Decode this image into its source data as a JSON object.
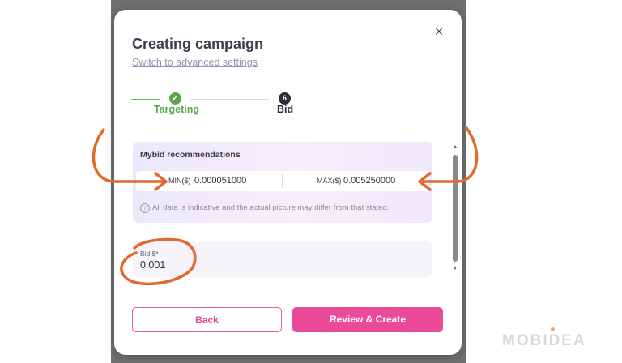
{
  "modal": {
    "title": "Creating campaign",
    "advanced_link": "Switch to advanced settings",
    "close_glyph": "×"
  },
  "stepper": {
    "steps": [
      {
        "label": "Targeting",
        "marker": "✓",
        "state": "completed"
      },
      {
        "label": "Bid",
        "marker": "6",
        "state": "current"
      }
    ]
  },
  "recommendations": {
    "title": "Mybid recommendations",
    "min_label": "MIN($)",
    "min_value": "0.000051000",
    "max_label": "MAX($)",
    "max_value": "0.005250000",
    "info_glyph": "i",
    "note": "All data is indicative and the actual picture may differ from that stated."
  },
  "bid": {
    "label": "Bid $*",
    "value": "0.001"
  },
  "scrollbar": {
    "up_glyph": "▲",
    "down_glyph": "▼"
  },
  "buttons": {
    "back": "Back",
    "create": "Review & Create"
  },
  "watermark": "MOBIDEA",
  "colors": {
    "accent_pink": "#ea4a98",
    "success_green": "#5ba64e",
    "annotation_orange": "#e06a2e"
  }
}
